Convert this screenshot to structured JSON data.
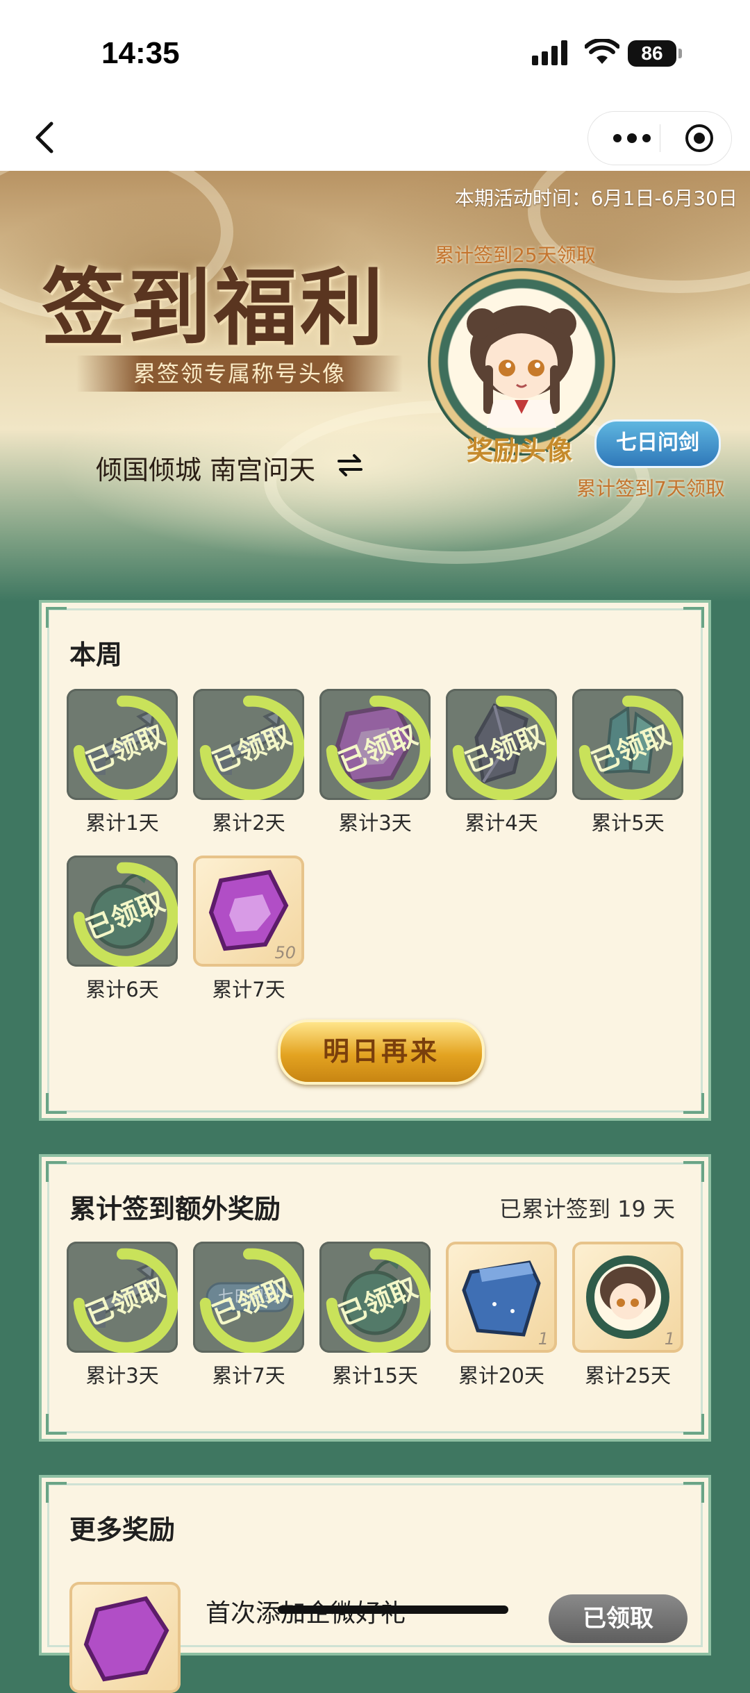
{
  "status_bar": {
    "time": "14:35",
    "battery": "86"
  },
  "banner": {
    "period": "本期活动时间：6月1日-6月30日",
    "title": "签到福利",
    "subtitle": "累签领专属称号头像",
    "username": "倾国倾城 南宫问天",
    "top_note": "累计签到25天领取",
    "avatar_label": "奖励头像",
    "badge": "七日问剑",
    "bottom_note": "累计签到7天领取"
  },
  "week": {
    "title": "本周",
    "claimed_text": "已领取",
    "items": [
      {
        "label": "累计1天",
        "icon": "broken-sword-icon",
        "claimed": true
      },
      {
        "label": "累计2天",
        "icon": "broken-sword-icon",
        "claimed": true
      },
      {
        "label": "累计3天",
        "icon": "purple-gem-icon",
        "claimed": true
      },
      {
        "label": "累计4天",
        "icon": "dark-crystal-icon",
        "claimed": true
      },
      {
        "label": "累计5天",
        "icon": "teal-crystal-icon",
        "claimed": true
      },
      {
        "label": "累计6天",
        "icon": "jade-fruit-icon",
        "claimed": true
      },
      {
        "label": "累计7天",
        "icon": "purple-gem-icon",
        "claimed": false,
        "qty": "50"
      }
    ],
    "button": "明日再来"
  },
  "extra": {
    "title": "累计签到额外奖励",
    "count_text": "已累计签到 19 天",
    "items": [
      {
        "label": "累计3天",
        "icon": "broken-sword-icon",
        "claimed": true
      },
      {
        "label": "累计7天",
        "icon": "title-badge-icon",
        "claimed": true,
        "badge_text": "七日问剑"
      },
      {
        "label": "累计15天",
        "icon": "jade-fruit-icon",
        "claimed": true
      },
      {
        "label": "累计20天",
        "icon": "blue-cloak-icon",
        "claimed": false,
        "qty": "1"
      },
      {
        "label": "累计25天",
        "icon": "avatar-frame-icon",
        "claimed": false,
        "qty": "1"
      }
    ]
  },
  "more": {
    "title": "更多奖励",
    "item_text": "首次添加企微好礼",
    "button": "已领取"
  }
}
